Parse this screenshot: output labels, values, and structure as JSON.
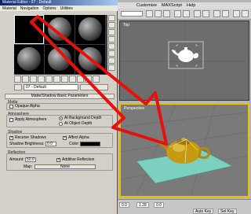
{
  "material_editor": {
    "title": "Material Editor - 07 - Default",
    "menu": [
      "Material",
      "Navigation",
      "Options",
      "Utilities"
    ],
    "material_name": "07 - Default",
    "rollout_title": "Matte/Shadow Basic Parameters",
    "matte": {
      "label": "Matte",
      "opaque_alpha": "Opaque Alpha"
    },
    "atmosphere": {
      "label": "Atmosphere",
      "apply_atmosphere": "Apply Atmosphere",
      "at_background_depth": "At Background Depth",
      "at_object_depth": "At Object Depth"
    },
    "shadow": {
      "label": "Shadow",
      "receive_shadows": "Receive Shadows",
      "affect_alpha": "Affect Alpha",
      "shadow_brightness_label": "Shadow Brightness:",
      "shadow_brightness_value": "0.0",
      "color_label": "Color:"
    },
    "reflection": {
      "label": "Reflection",
      "amount_label": "Amount:",
      "amount_value": "50.0",
      "additive_reflection": "Additive Reflection",
      "map_label": "Map:",
      "map_value": "None"
    }
  },
  "max_window": {
    "menu": [
      "Customize",
      "MAXScript",
      "Help"
    ],
    "viewport_top_label": "Top",
    "viewport_persp_label": "Perspective",
    "status": {
      "x_value": "0.0",
      "y_value": "1.28",
      "z_value": "0.0",
      "auto_key": "Auto Key",
      "set_key": "Set Key"
    }
  },
  "colors": {
    "arrow": "#e8100c",
    "ground_plane": "#7bd0c0",
    "teapot": "#c89a10",
    "selection_border": "#e6c200"
  }
}
